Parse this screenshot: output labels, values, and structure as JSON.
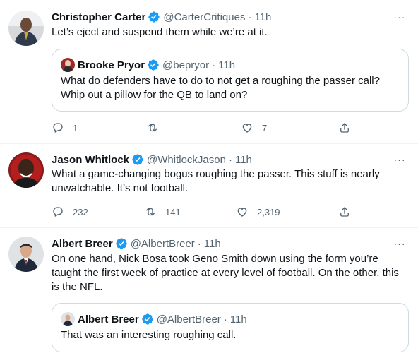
{
  "tweets": [
    {
      "name": "Christopher Carter",
      "handle": "@CarterCritiques",
      "separator": "·",
      "time": "11h",
      "text": "Let’s eject and suspend them while we’re at it.",
      "quote": {
        "name": "Brooke Pryor",
        "handle": "@bepryor",
        "separator": "·",
        "time": "11h",
        "text": "What do defenders have to do to not get a roughing the passer call? Whip out a pillow for the QB to land on?"
      },
      "replies": "1",
      "retweets": "",
      "likes": "7"
    },
    {
      "name": "Jason Whitlock",
      "handle": "@WhitlockJason",
      "separator": "·",
      "time": "11h",
      "text": "What a game-changing bogus roughing the passer. This stuff is nearly unwatchable. It’s not football.",
      "replies": "232",
      "retweets": "141",
      "likes": "2,319"
    },
    {
      "name": "Albert Breer",
      "handle": "@AlbertBreer",
      "separator": "·",
      "time": "11h",
      "text": "On one hand, Nick Bosa took Geno Smith down using the form you’re taught the first week of practice at every level of football. On the other, this is the NFL.",
      "quote": {
        "name": "Albert Breer",
        "handle": "@AlbertBreer",
        "separator": "·",
        "time": "11h",
        "text": "That was an interesting roughing call."
      }
    }
  ],
  "more_label": "···",
  "colors": {
    "verified": "#1d9bf0",
    "secondary_text": "#536471",
    "border": "#cfd9de"
  },
  "icons": [
    "verified-badge-icon",
    "more-icon",
    "reply-icon",
    "retweet-icon",
    "like-icon",
    "share-icon"
  ]
}
